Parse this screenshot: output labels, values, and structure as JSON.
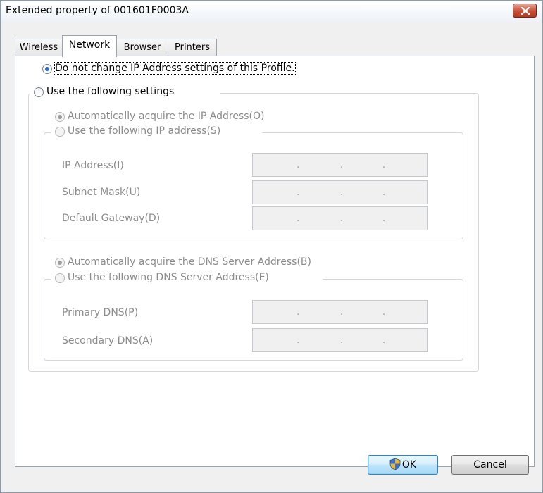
{
  "window": {
    "title": "Extended property of 001601F0003A"
  },
  "tabs": [
    {
      "label": "Wireless"
    },
    {
      "label": "Network"
    },
    {
      "label": "Browser"
    },
    {
      "label": "Printers"
    }
  ],
  "network": {
    "no_change_label": "Do not change IP Address settings of this Profile.",
    "use_following_label": "Use the following settings",
    "auto_ip_label": "Automatically acquire the IP Address(O)",
    "use_ip_label": "Use the following IP address(S)",
    "fields": {
      "ip_address": {
        "label": "IP Address(I)",
        "value": ". . ."
      },
      "subnet_mask": {
        "label": "Subnet Mask(U)",
        "value": ". . ."
      },
      "default_gateway": {
        "label": "Default Gateway(D)",
        "value": ". . ."
      }
    },
    "auto_dns_label": "Automatically acquire the DNS Server Address(B)",
    "use_dns_label": "Use the following DNS Server Address(E)",
    "dns": {
      "primary": {
        "label": "Primary DNS(P)",
        "value": ". . ."
      },
      "secondary": {
        "label": "Secondary DNS(A)",
        "value": ". . ."
      }
    }
  },
  "buttons": {
    "ok": "OK",
    "cancel": "Cancel"
  },
  "icons": {
    "close": "close-icon",
    "shield": "uac-shield-icon"
  },
  "colors": {
    "close_button": "#c74d36",
    "radio_checked": "#2b6fc6",
    "disabled_text": "#8c8c8c"
  }
}
